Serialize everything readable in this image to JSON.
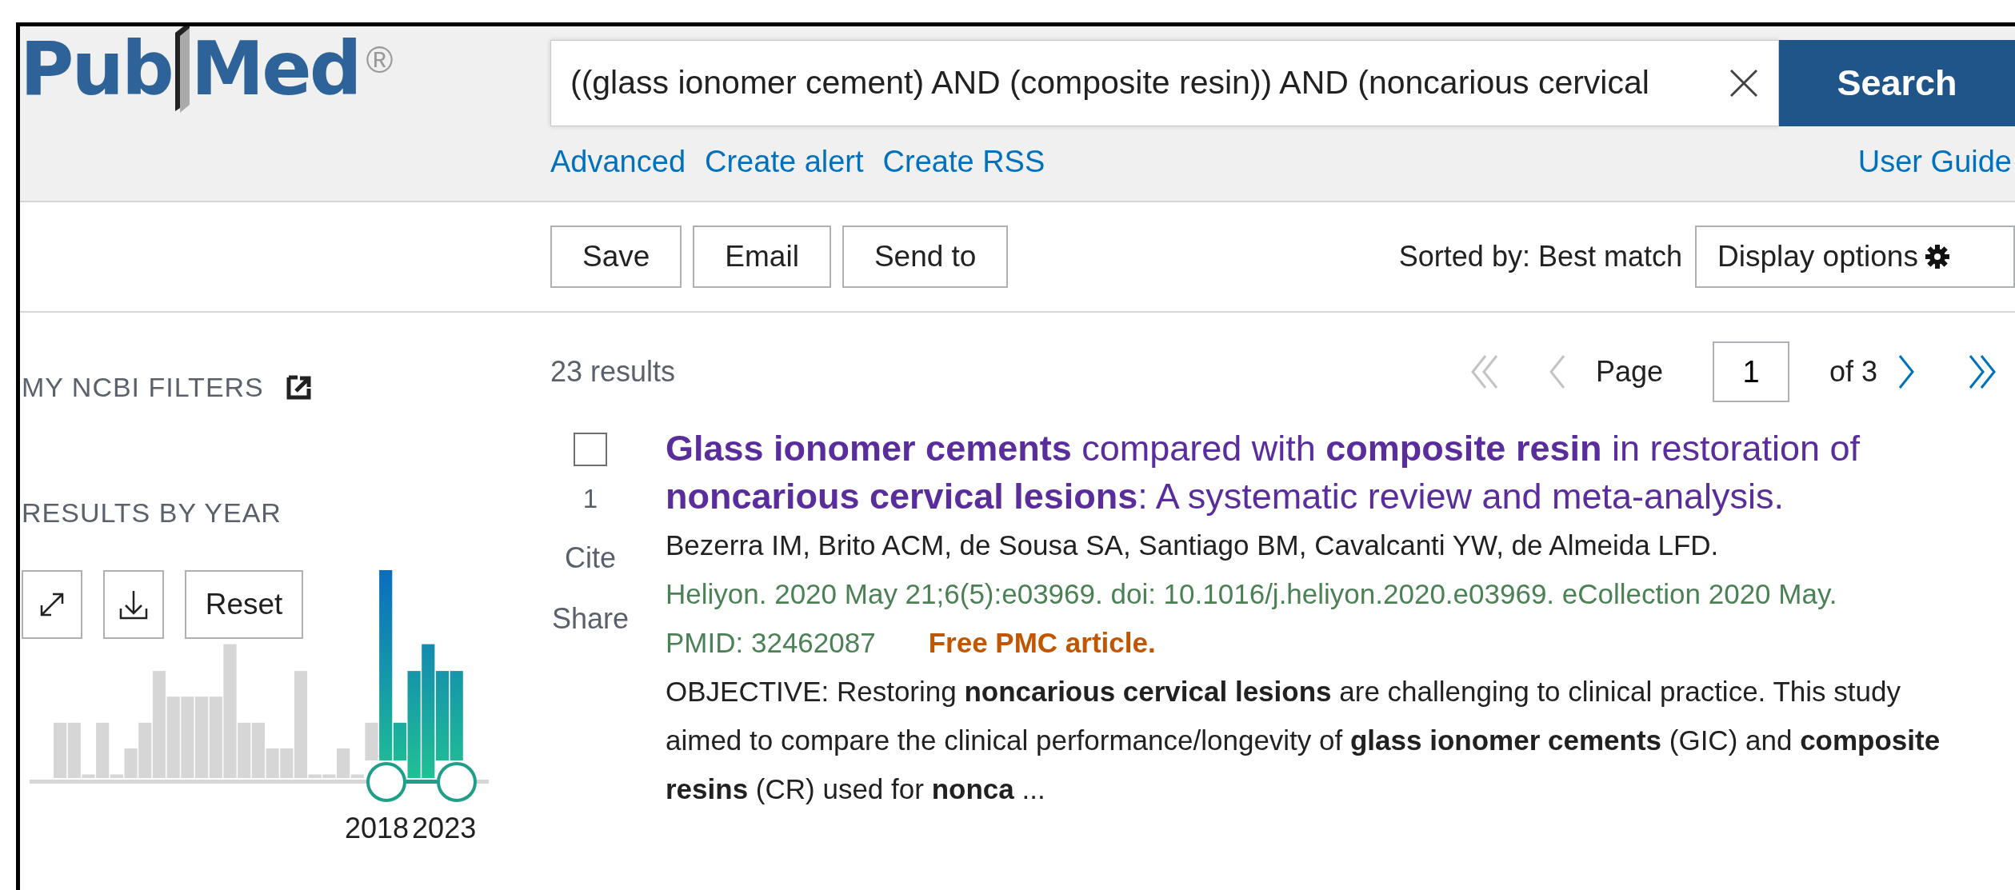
{
  "logo": {
    "parts": [
      "Pub",
      "Med"
    ],
    "registered": "®"
  },
  "search": {
    "value": "((glass ionomer cement) AND (composite resin)) AND (noncarious cervical",
    "button": "Search"
  },
  "search_links": [
    "Advanced",
    "Create alert",
    "Create RSS"
  ],
  "user_guide": "User Guide",
  "toolbar": {
    "buttons": [
      "Save",
      "Email",
      "Send to"
    ],
    "sorted_by": "Sorted by: Best match",
    "display_options": "Display options"
  },
  "sidebar": {
    "filters_title": "MY NCBI FILTERS",
    "year_title": "RESULTS BY YEAR",
    "reset": "Reset",
    "range_labels": [
      "2018",
      "2023"
    ]
  },
  "results": {
    "count": "23 results",
    "pagination": {
      "label": "Page",
      "value": "1",
      "of": "of 3",
      "arrows": [
        {
          "kind": "first",
          "disabled": true
        },
        {
          "kind": "prev",
          "disabled": true
        },
        {
          "kind": "next",
          "disabled": false
        },
        {
          "kind": "last",
          "disabled": false
        }
      ]
    },
    "articles": [
      {
        "checked": false,
        "number": "1",
        "actions": [
          "Cite",
          "Share"
        ],
        "title": "**Glass ionomer cements** compared with **composite resin** in restoration of **noncarious cervical lesions**: A systematic review and meta-analysis.",
        "authors": "Bezerra IM, Brito ACM, de Sousa SA, Santiago BM, Cavalcanti YW, de Almeida LFD.",
        "citation": "Heliyon. 2020 May 21;6(5):e03969. doi: 10.1016/j.heliyon.2020.e03969. eCollection 2020 May.",
        "pmid": "PMID: 32462087",
        "free_text": "Free PMC article.",
        "snippet": "OBJECTIVE: Restoring **noncarious cervical lesions** are challenging to clinical practice. This study aimed to compare the clinical performance/longevity of **glass ionomer cements** (GIC) and **composite resins** (CR) used for **nonca** ..."
      }
    ]
  }
}
